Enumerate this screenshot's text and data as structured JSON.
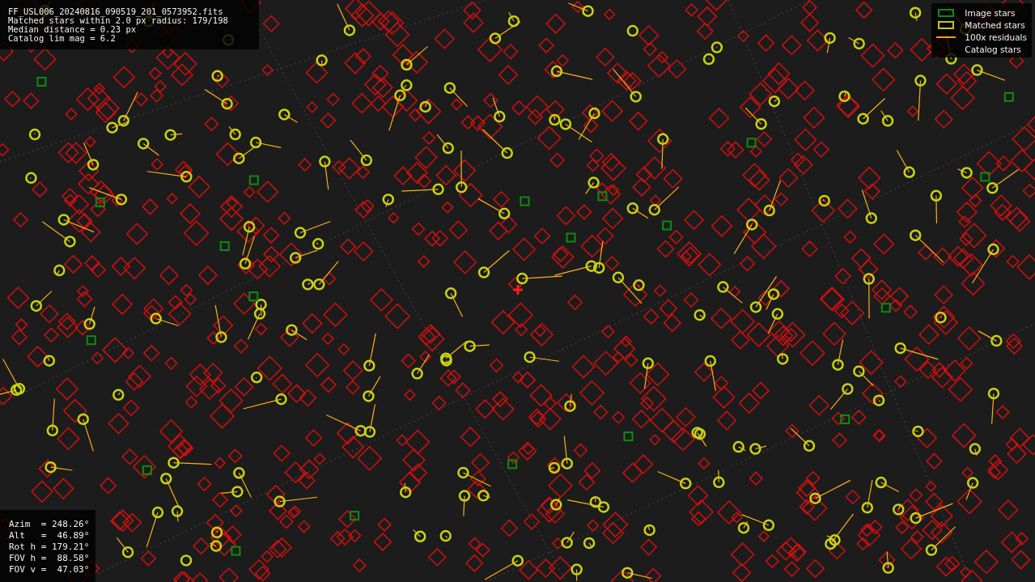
{
  "image_info": {
    "lines": [
      "FF_USL006_20240816_090519_201_0573952.fits",
      "Matched stars within 2.0 px radius: 179/198",
      "Median distance = 0.23 px",
      "Catalog lim mag = 6.2"
    ]
  },
  "legend": {
    "items": [
      {
        "label": "Image stars",
        "kind": "box",
        "color": "#0f8c0f"
      },
      {
        "label": "Matched stars",
        "kind": "box",
        "color": "#c8c814"
      },
      {
        "label": "100x residuals",
        "kind": "line",
        "color": "#ff9a1a"
      },
      {
        "label": "Catalog stars",
        "kind": "none"
      }
    ]
  },
  "pointing": {
    "lines": [
      "Azim  = 248.26°",
      "Alt   =  46.89°",
      "Rot h = 179.21°",
      "FOV h =  88.58°",
      "FOV v =  47.03°"
    ]
  }
}
